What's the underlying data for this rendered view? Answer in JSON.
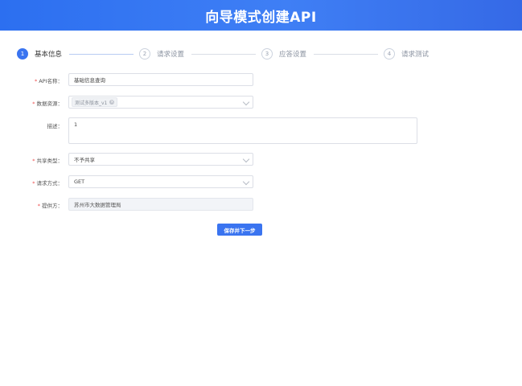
{
  "header": {
    "title": "向导模式创建API"
  },
  "steps": [
    {
      "number": "1",
      "label": "基本信息",
      "active": true
    },
    {
      "number": "2",
      "label": "请求设置",
      "active": false
    },
    {
      "number": "3",
      "label": "应答设置",
      "active": false
    },
    {
      "number": "4",
      "label": "请求测试",
      "active": false
    }
  ],
  "form": {
    "api_name": {
      "label": "API名称：",
      "required": true,
      "value": "基础信息查询"
    },
    "datasource": {
      "label": "数据资源：",
      "required": true,
      "tag": "测试多版本_v1"
    },
    "description": {
      "label": "描述：",
      "required": false,
      "value": "1"
    },
    "share_type": {
      "label": "共享类型：",
      "required": true,
      "value": "不予共享"
    },
    "method": {
      "label": "请求方式：",
      "required": true,
      "value": "GET"
    },
    "provider": {
      "label": "提供方：",
      "required": true,
      "value": "苏州市大数据管理局"
    }
  },
  "actions": {
    "save_next": "保存并下一步"
  },
  "colors": {
    "primary": "#3a74f0",
    "required": "#ee4d4d"
  }
}
